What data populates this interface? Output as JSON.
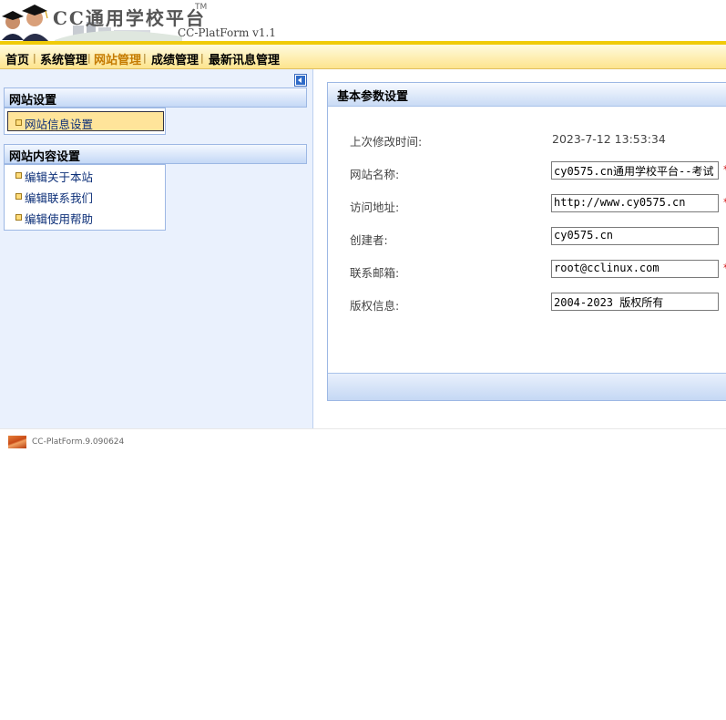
{
  "header": {
    "app_title": "CC通用学校平台",
    "trademark": "TM",
    "subtitle": "CC-PlatForm v1.1"
  },
  "nav": {
    "items": [
      {
        "label": "首页",
        "active": false
      },
      {
        "label": "系统管理",
        "active": false
      },
      {
        "label": "网站管理",
        "active": true
      },
      {
        "label": "成绩管理",
        "active": false
      },
      {
        "label": "最新讯息管理",
        "active": false
      }
    ],
    "separator": "|"
  },
  "sidebar": {
    "groups": [
      {
        "title": "网站设置",
        "items": [
          {
            "label": "网站信息设置",
            "selected": true
          }
        ]
      },
      {
        "title": "网站内容设置",
        "items": [
          {
            "label": "编辑关于本站",
            "selected": false
          },
          {
            "label": "编辑联系我们",
            "selected": false
          },
          {
            "label": "编辑使用帮助",
            "selected": false
          }
        ]
      }
    ]
  },
  "panel": {
    "title": "基本参数设置",
    "last_modified_label": "上次修改时间:",
    "last_modified_value": "2023-7-12 13:53:34",
    "fields": [
      {
        "label": "网站名称:",
        "value": "cy0575.cn通用学校平台--考试",
        "required": true
      },
      {
        "label": "访问地址:",
        "value": "http://www.cy0575.cn",
        "required": true
      },
      {
        "label": "创建者:",
        "value": "cy0575.cn",
        "required": false
      },
      {
        "label": "联系邮箱:",
        "value": "root@cclinux.com",
        "required": true
      },
      {
        "label": "版权信息:",
        "value": "2004-2023 版权所有",
        "required": false
      }
    ],
    "required_mark": "*"
  },
  "footer": {
    "text": "CC-PlatForm.9.090624"
  },
  "colors": {
    "nav_accent": "#f0cb0a",
    "nav_active_text": "#c57b00",
    "sidebar_bg": "#eaf1fd",
    "selected_item_bg": "#ffe49a",
    "required_mark": "#d00000"
  }
}
